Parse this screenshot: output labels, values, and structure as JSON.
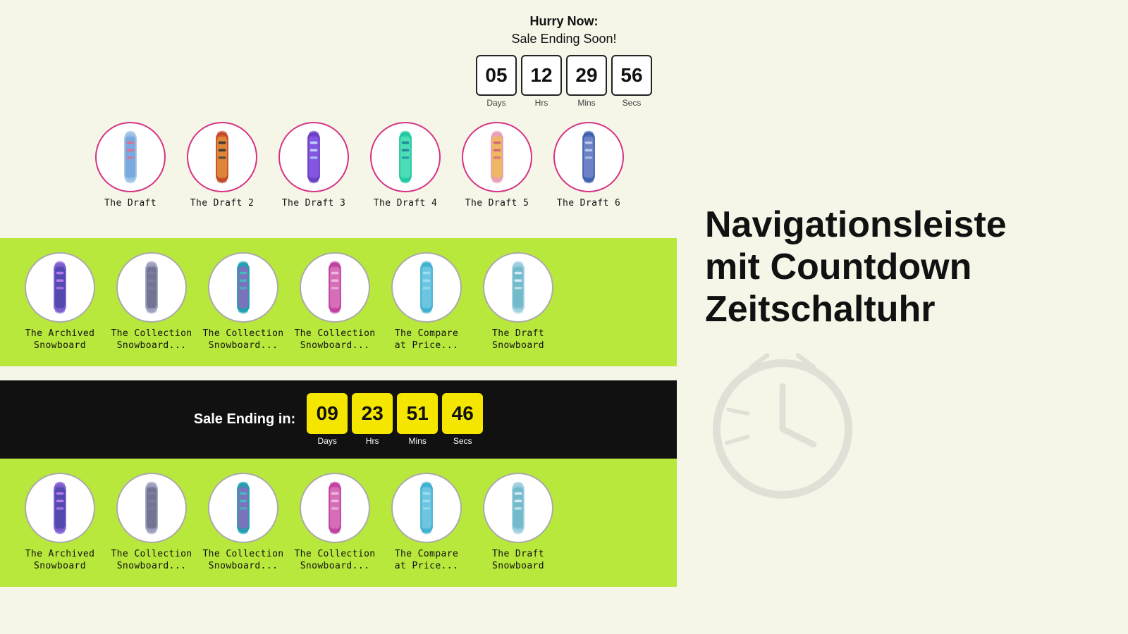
{
  "topSection": {
    "hurry_line1": "Hurry Now:",
    "hurry_line2": "Sale Ending Soon!",
    "countdown": {
      "days": "05",
      "hrs": "12",
      "mins": "29",
      "secs": "56",
      "labels": [
        "Days",
        "Hrs",
        "Mins",
        "Secs"
      ]
    },
    "products": [
      {
        "name": "The Draft",
        "color1": "#a0c4e8",
        "color2": "#6a9fd8",
        "accent": "#e86a8a"
      },
      {
        "name": "The Draft 2",
        "color1": "#c44a2a",
        "color2": "#e8a040",
        "accent": "#333"
      },
      {
        "name": "The Draft 3",
        "color1": "#6a40c8",
        "color2": "#9060e8",
        "accent": "#c0e0ff"
      },
      {
        "name": "The Draft 4",
        "color1": "#20c8a0",
        "color2": "#60e8c0",
        "accent": "#2080a0"
      },
      {
        "name": "The Draft 5",
        "color1": "#e8a0b8",
        "color2": "#f0c040",
        "accent": "#d06080"
      },
      {
        "name": "The Draft 6",
        "color1": "#4060b0",
        "color2": "#8090d0",
        "accent": "#c0d0f0"
      }
    ]
  },
  "middleSection": {
    "products": [
      {
        "name": "The Archived\nSnowboard",
        "color1": "#8060d0",
        "color2": "#4040a0",
        "accent": "#c080ff"
      },
      {
        "name": "The Collection\nSnowboard...",
        "color1": "#a0a0c0",
        "color2": "#606080",
        "accent": "#8080a0"
      },
      {
        "name": "The Collection\nSnowboard...",
        "color1": "#20a0b0",
        "color2": "#a060c0",
        "accent": "#40c0c0"
      },
      {
        "name": "The Collection\nSnowboard...",
        "color1": "#c040a0",
        "color2": "#e080c0",
        "accent": "#f0c0e0"
      },
      {
        "name": "The Compare\nat Price...",
        "color1": "#40b0d0",
        "color2": "#80d0e8",
        "accent": "#a0e0f0"
      },
      {
        "name": "The Draft\nSnowboard",
        "color1": "#a0d0e0",
        "color2": "#60b0c0",
        "accent": "#e0f0f8"
      }
    ]
  },
  "blackBanner": {
    "label": "Sale Ending in:",
    "countdown": {
      "days": "09",
      "hrs": "23",
      "mins": "51",
      "secs": "46",
      "labels": [
        "Days",
        "Hrs",
        "Mins",
        "Secs"
      ]
    }
  },
  "bottomSection": {
    "products": [
      {
        "name": "The Archived\nSnowboard",
        "color1": "#8060d0",
        "color2": "#4040a0",
        "accent": "#c080ff"
      },
      {
        "name": "The Collection\nSnowboard...",
        "color1": "#a0a0c0",
        "color2": "#606080",
        "accent": "#8080a0"
      },
      {
        "name": "The Collection\nSnowboard...",
        "color1": "#20a0b0",
        "color2": "#a060c0",
        "accent": "#40c0c0"
      },
      {
        "name": "The Collection\nSnowboard...",
        "color1": "#c040a0",
        "color2": "#e080c0",
        "accent": "#f0c0e0"
      },
      {
        "name": "The Compare\nat Price...",
        "color1": "#40b0d0",
        "color2": "#80d0e8",
        "accent": "#a0e0f0"
      },
      {
        "name": "The Draft\nSnowboard",
        "color1": "#a0d0e0",
        "color2": "#60b0c0",
        "accent": "#e0f0f8"
      }
    ]
  },
  "rightPanel": {
    "title_line1": "Navigationsleiste",
    "title_line2": "mit Countdown",
    "title_line3": "Zeitschaltuhr"
  }
}
